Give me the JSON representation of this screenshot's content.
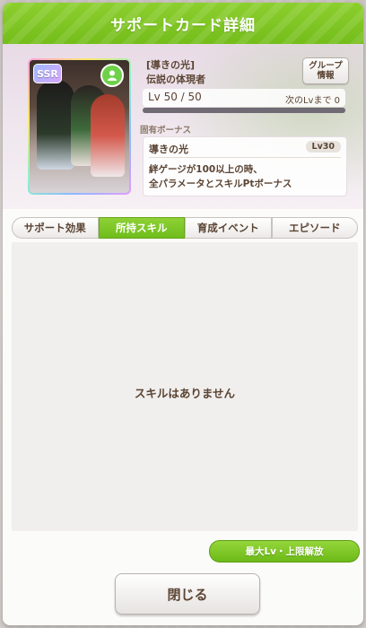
{
  "header": {
    "title": "サポートカード詳細"
  },
  "card": {
    "rarity": "SSR",
    "type_icon": "group-speed-icon",
    "title": "[導きの光]",
    "name": "伝説の体現者"
  },
  "group_button": {
    "line1": "グループ",
    "line2": "情報"
  },
  "level": {
    "text": "Lv 50 / 50",
    "next_label": "次のLvまで 0",
    "progress": 1.0
  },
  "unique_bonus": {
    "label": "固有ボーナス",
    "name": "導きの光",
    "level": "Lv30",
    "desc_line1": "絆ゲージが100以上の時、",
    "desc_line2": "全パラメータとスキルPtボーナス"
  },
  "tabs": [
    {
      "label": "サポート効果",
      "active": false
    },
    {
      "label": "所持スキル",
      "active": true
    },
    {
      "label": "育成イベント",
      "active": false
    },
    {
      "label": "エピソード",
      "active": false
    }
  ],
  "content": {
    "empty_message": "スキルはありません"
  },
  "buttons": {
    "max_level": "最大Lv・上限解放",
    "close": "閉じる"
  },
  "colors": {
    "accent": "#7ac322",
    "text": "#5b4433"
  }
}
